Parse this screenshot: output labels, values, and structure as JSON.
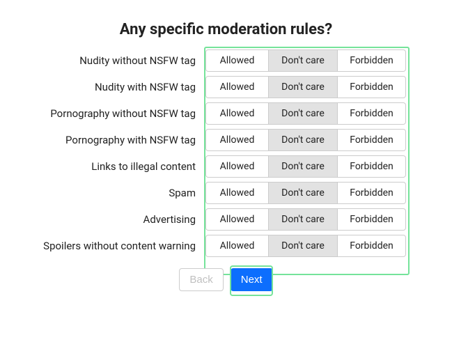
{
  "title": "Any specific moderation rules?",
  "options": {
    "allowed": "Allowed",
    "dontcare": "Don't care",
    "forbidden": "Forbidden"
  },
  "rules": [
    {
      "label": "Nudity without NSFW tag",
      "selected": "dontcare"
    },
    {
      "label": "Nudity with NSFW tag",
      "selected": "dontcare"
    },
    {
      "label": "Pornography without NSFW tag",
      "selected": "dontcare"
    },
    {
      "label": "Pornography with NSFW tag",
      "selected": "dontcare"
    },
    {
      "label": "Links to illegal content",
      "selected": "dontcare"
    },
    {
      "label": "Spam",
      "selected": "dontcare"
    },
    {
      "label": "Advertising",
      "selected": "dontcare"
    },
    {
      "label": "Spoilers without content warning",
      "selected": "dontcare"
    }
  ],
  "buttons": {
    "back": "Back",
    "next": "Next"
  }
}
